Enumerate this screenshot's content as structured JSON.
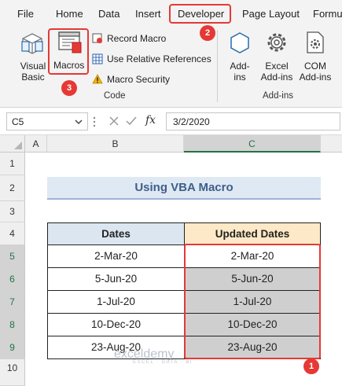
{
  "ribbon_tabs": [
    "File",
    "Home",
    "Data",
    "Insert",
    "Developer",
    "Page Layout",
    "Formu"
  ],
  "code_group": {
    "visual_basic": "Visual Basic",
    "macros": "Macros",
    "record_macro": "Record Macro",
    "relative_refs": "Use Relative References",
    "macro_security": "Macro Security",
    "label": "Code"
  },
  "addins_group": {
    "addins": "Add-ins",
    "excel_addins": "Excel Add-ins",
    "com_addins": "COM Add-ins",
    "label": "Add-ins"
  },
  "badges": [
    "1",
    "2",
    "3"
  ],
  "formula_bar": {
    "name_box": "C5",
    "fx": "fx",
    "formula": "3/2/2020"
  },
  "columns": [
    "A",
    "B",
    "C"
  ],
  "rows": [
    "1",
    "2",
    "3",
    "4",
    "5",
    "6",
    "7",
    "8",
    "9",
    "10"
  ],
  "sheet": {
    "title": "Using VBA Macro",
    "header_dates": "Dates",
    "header_updated": "Updated Dates",
    "dates": [
      "2-Mar-20",
      "5-Jun-20",
      "1-Jul-20",
      "10-Dec-20",
      "23-Aug-20"
    ],
    "updated_dates": [
      "2-Mar-20",
      "5-Jun-20",
      "1-Jul-20",
      "10-Dec-20",
      "23-Aug-20"
    ]
  },
  "watermark": {
    "name": "exceldemy",
    "tagline": "EXCEL · DATA · BI"
  },
  "colors": {
    "highlight": "#e53935",
    "excel_green": "#217346"
  }
}
